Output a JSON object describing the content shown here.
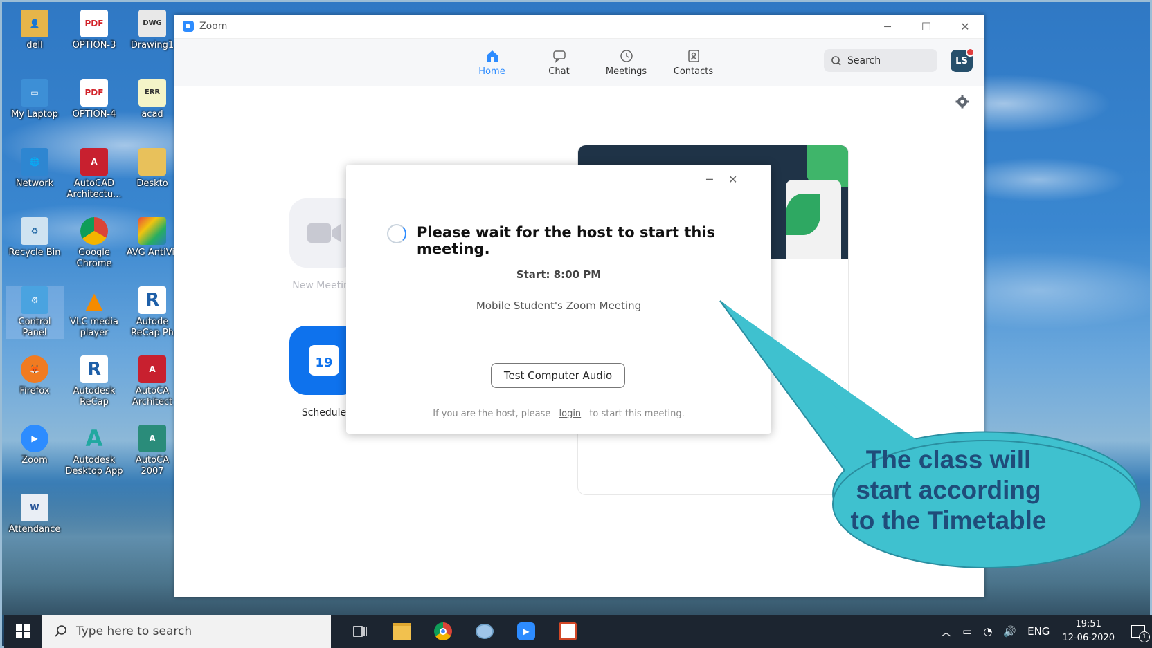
{
  "desktop": {
    "icons": [
      {
        "label": "dell",
        "icon": "user-folder-icon"
      },
      {
        "label": "OPTION-3",
        "icon": "pdf-icon"
      },
      {
        "label": "Drawing1",
        "icon": "dwg-file-icon"
      },
      {
        "label": "My Laptop",
        "icon": "computer-icon"
      },
      {
        "label": "OPTION-4",
        "icon": "pdf-icon"
      },
      {
        "label": "acad",
        "icon": "error-file-icon"
      },
      {
        "label": "Network",
        "icon": "network-icon"
      },
      {
        "label": "AutoCAD Architectu...",
        "icon": "autocad-icon"
      },
      {
        "label": "Deskto",
        "icon": "folder-icon"
      },
      {
        "label": "Recycle Bin",
        "icon": "recycle-bin-icon"
      },
      {
        "label": "Google Chrome",
        "icon": "chrome-icon"
      },
      {
        "label": "AVG AntiVir",
        "icon": "avg-icon"
      },
      {
        "label": "Control Panel",
        "icon": "control-panel-icon"
      },
      {
        "label": "VLC media player",
        "icon": "vlc-icon"
      },
      {
        "label": "Autode ReCap Ph",
        "icon": "recap-photo-icon"
      },
      {
        "label": "Firefox",
        "icon": "firefox-icon"
      },
      {
        "label": "Autodesk ReCap",
        "icon": "recap-icon"
      },
      {
        "label": "AutoCA Architect",
        "icon": "autocad-icon"
      },
      {
        "label": "Zoom",
        "icon": "zoom-icon"
      },
      {
        "label": "Autodesk Desktop App",
        "icon": "autodesk-app-icon"
      },
      {
        "label": "AutoCA 2007",
        "icon": "autocad-2007-icon"
      },
      {
        "label": "Attendance",
        "icon": "word-doc-icon"
      }
    ]
  },
  "zoom": {
    "window_title": "Zoom",
    "tabs": [
      {
        "label": "Home",
        "icon": "home-icon"
      },
      {
        "label": "Chat",
        "icon": "chat-icon"
      },
      {
        "label": "Meetings",
        "icon": "clock-icon"
      },
      {
        "label": "Contacts",
        "icon": "contacts-icon"
      }
    ],
    "search_placeholder": "Search",
    "avatar_initials": "LS",
    "new_meeting_label": "New Meeting",
    "schedule_label": "Schedule",
    "schedule_day": "19"
  },
  "dialog": {
    "headline": "Please wait for the host to start this meeting.",
    "start_time": "Start: 8:00 PM",
    "meeting_name": "Mobile Student's Zoom Meeting",
    "test_audio_label": "Test Computer Audio",
    "host_prefix": "If you are the host, please",
    "login_link": "login",
    "host_suffix": "to start this meeting."
  },
  "callout": {
    "text": "The class will start according to the Timetable",
    "fill": "#3fc1cf",
    "text_color": "#1f4c7a"
  },
  "taskbar": {
    "search_placeholder": "Type here to search",
    "language": "ENG",
    "time": "19:51",
    "date": "12-06-2020",
    "notification_count": "1"
  },
  "colors": {
    "zoom_blue": "#2d8cff",
    "taskbar": "#1c2530"
  }
}
